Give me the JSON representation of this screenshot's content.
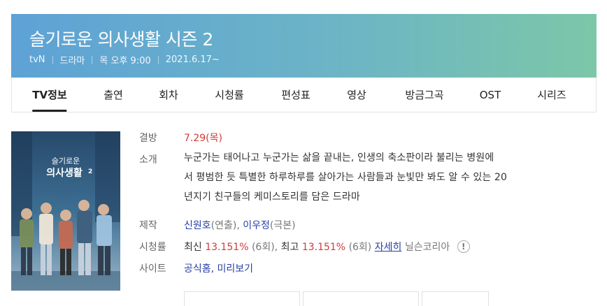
{
  "header": {
    "title": "슬기로운 의사생활 시즌 2",
    "channel": "tvN",
    "genre": "드라마",
    "schedule": "목 오후 9:00",
    "premiere": "2021.6.17~"
  },
  "tabs": [
    {
      "label": "TV정보",
      "active": true
    },
    {
      "label": "출연"
    },
    {
      "label": "회차"
    },
    {
      "label": "시청률"
    },
    {
      "label": "편성표"
    },
    {
      "label": "영상"
    },
    {
      "label": "방금그곡"
    },
    {
      "label": "OST"
    },
    {
      "label": "시리즈"
    }
  ],
  "poster": {
    "title_line1": "슬기로운",
    "title_line2": "의사생활",
    "season_mark": "2"
  },
  "info": {
    "airing_label": "결방",
    "airing_value": "7.29(목)",
    "intro_label": "소개",
    "intro_line1": "누군가는 태어나고 누군가는 삶을 끝내는, 인생의 축소판이라 불리는 병원에",
    "intro_line2": "서 평범한 듯 특별한 하루하루를 살아가는 사람들과 눈빛만 봐도 알 수 있는 20",
    "intro_line3": "년지기 친구들의 케미스토리를 담은 드라마",
    "production_label": "제작",
    "director": "신원호",
    "director_role": "(연출),",
    "writer": "이우정",
    "writer_role": "(극본)",
    "ratings_label": "시청률",
    "ratings_latest_prefix": "최신",
    "ratings_latest_value": "13.151%",
    "ratings_latest_ep": "(6회),",
    "ratings_max_prefix": "최고",
    "ratings_max_value": "13.151%",
    "ratings_max_ep": "(6회)",
    "ratings_more": "자세히",
    "ratings_source": "닐슨코리아",
    "ratings_info_icon": "!",
    "site_label": "사이트",
    "site_official": "공식홈,",
    "site_preview": "미리보기"
  }
}
